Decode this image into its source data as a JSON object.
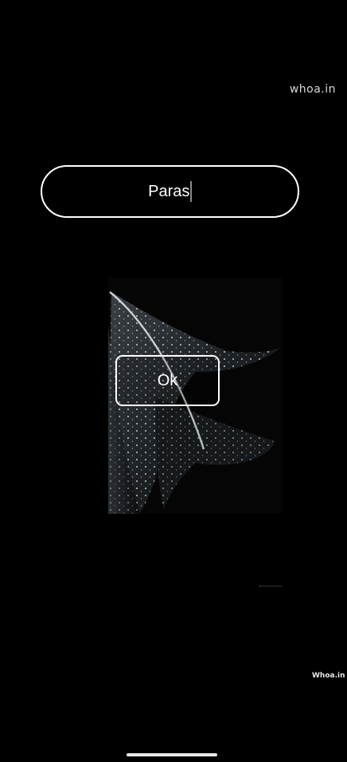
{
  "watermark": {
    "top_text": "whoa.in",
    "bottom_text": "Whoa.in"
  },
  "name_input": {
    "value": "Paras"
  },
  "ok_button": {
    "label": "Ok"
  },
  "background_image": {
    "icon": "feather-with-water-drops"
  },
  "colors": {
    "background": "#000000",
    "border": "#ffffff",
    "text": "#ffffff"
  }
}
